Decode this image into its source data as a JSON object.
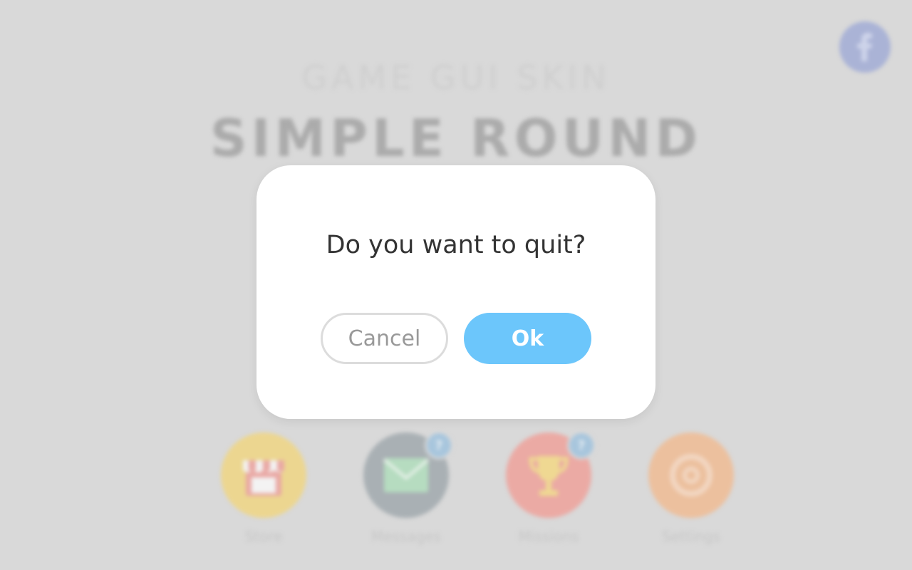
{
  "background": {
    "subtitle": "GAME GUI SKIN",
    "title": "SIMPLE ROUND",
    "social": {
      "icon": "facebook-icon",
      "glyph": "f"
    },
    "menu": [
      {
        "label": "Store",
        "icon": "store-icon",
        "color": "#ecd690"
      },
      {
        "label": "Messages",
        "icon": "envelope-icon",
        "color": "#a9b0b4",
        "badge": "?"
      },
      {
        "label": "Missions",
        "icon": "trophy-icon",
        "color": "#ebaaa4",
        "badge": "?"
      },
      {
        "label": "Settings",
        "icon": "gear-icon",
        "color": "#ecc09e"
      }
    ]
  },
  "dialog": {
    "question": "Do you want to quit?",
    "cancel_label": "Cancel",
    "ok_label": "Ok"
  },
  "colors": {
    "ok_button": "#6cc6fb",
    "overlay": "#d9d9d9"
  }
}
